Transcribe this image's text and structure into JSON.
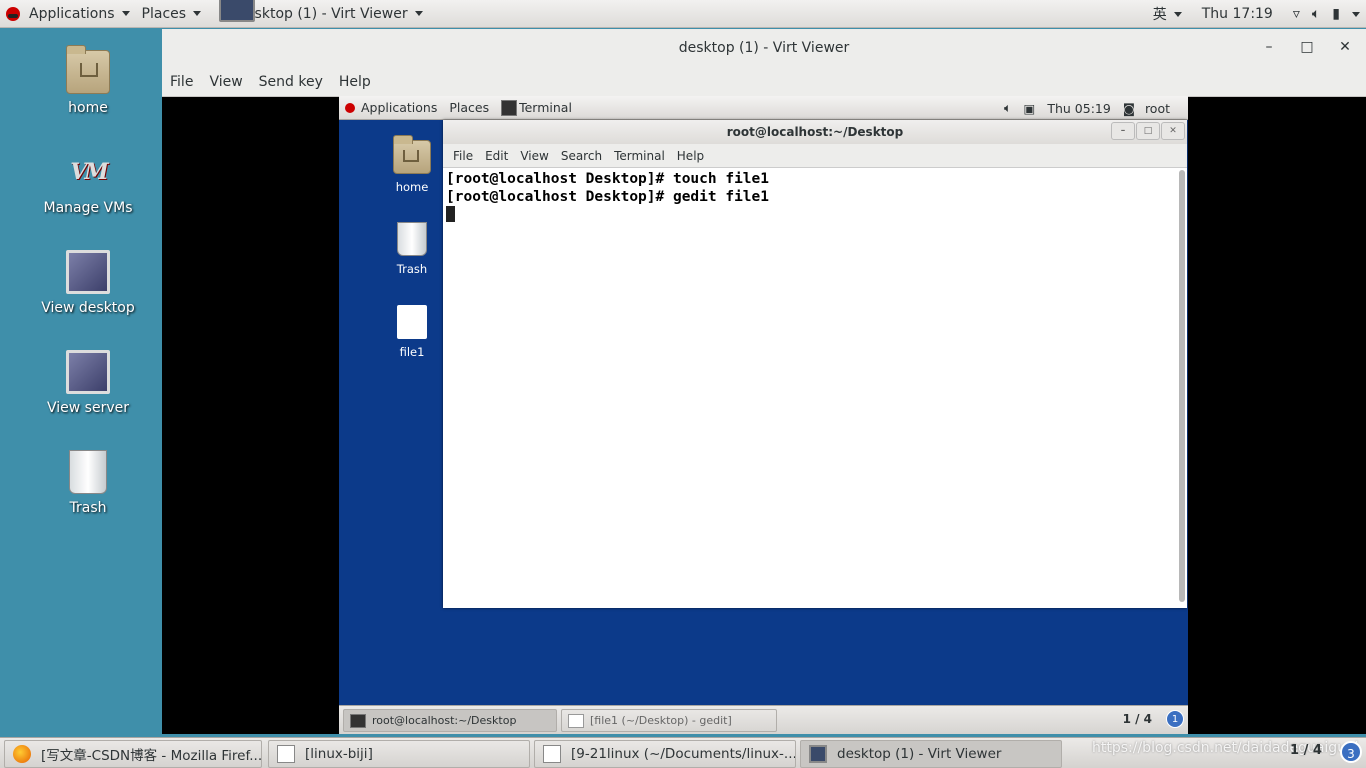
{
  "host_topbar": {
    "applications": "Applications",
    "places": "Places",
    "window_title": "desktop (1) - Virt Viewer",
    "input_method": "英",
    "clock": "Thu 17:19"
  },
  "host_desktop": {
    "icons": [
      {
        "label": "home"
      },
      {
        "label": "Manage VMs"
      },
      {
        "label": "View desktop"
      },
      {
        "label": "View server"
      },
      {
        "label": "Trash"
      }
    ]
  },
  "virt_viewer": {
    "title": "desktop (1) - Virt Viewer",
    "menu": [
      "File",
      "View",
      "Send key",
      "Help"
    ]
  },
  "guest": {
    "topbar": {
      "applications": "Applications",
      "places": "Places",
      "terminal": "Terminal",
      "clock": "Thu 05:19",
      "user": "root"
    },
    "icons": [
      {
        "label": "home"
      },
      {
        "label": "Trash"
      },
      {
        "label": "file1"
      }
    ],
    "terminal": {
      "title": "root@localhost:~/Desktop",
      "menu": [
        "File",
        "Edit",
        "View",
        "Search",
        "Terminal",
        "Help"
      ],
      "lines": [
        "[root@localhost Desktop]# touch file1",
        "[root@localhost Desktop]# gedit file1"
      ]
    },
    "taskbar": {
      "tasks": [
        "root@localhost:~/Desktop",
        "[file1 (~/Desktop) - gedit]"
      ],
      "pager": "1 / 4",
      "badge": "1"
    }
  },
  "host_taskbar": {
    "tasks": [
      "[写文章-CSDN博客 - Mozilla Firef...",
      "[linux-biji]",
      "[9-21linux (~/Documents/linux-...",
      "desktop (1) - Virt Viewer"
    ],
    "watermark": "https://blog.csdn.net/daidadeguaiguai",
    "pager": "1 / 4",
    "badge": "3"
  },
  "colors": {
    "host_desktop": "#3f8faa",
    "guest_desktop": "#0c3a8a",
    "badge": "#3b6fc1"
  }
}
